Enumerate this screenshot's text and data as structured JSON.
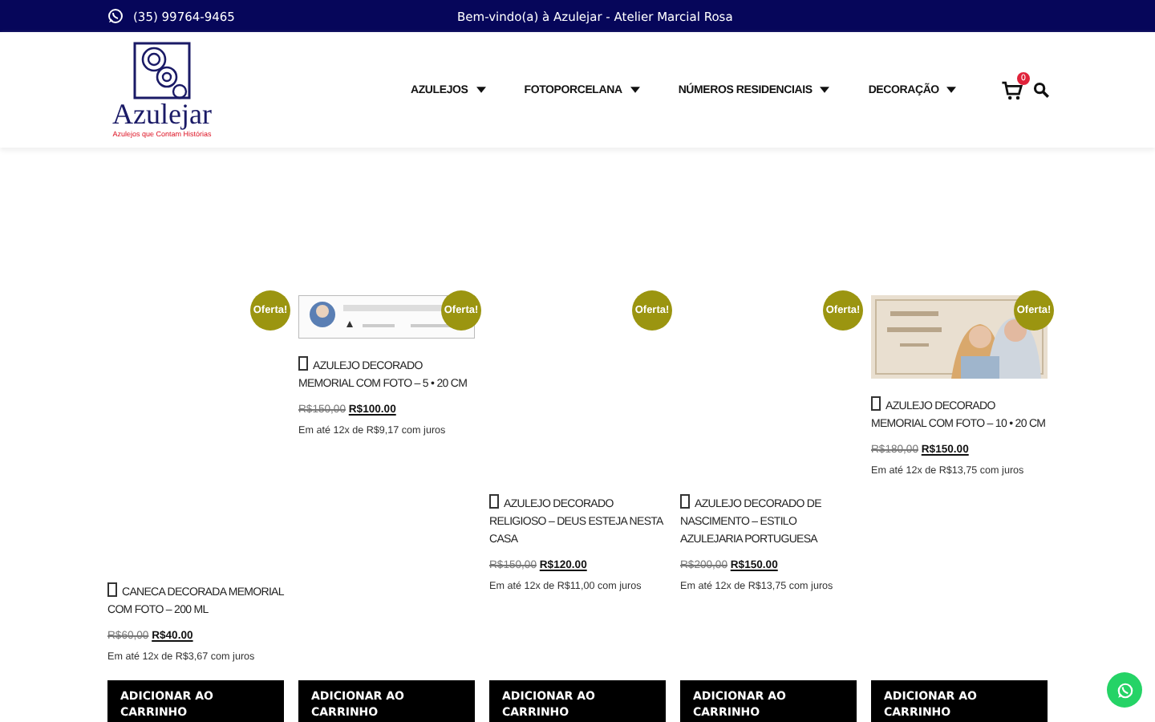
{
  "topbar": {
    "phone": "(35) 99764-9465",
    "welcome": "Bem-vindo(a) à Azulejar - Atelier Marcial Rosa"
  },
  "logo": {
    "name": "Azulejar",
    "tagline": "Azulejos que Contam Histórias"
  },
  "nav": [
    {
      "label": "AZULEJOS"
    },
    {
      "label": "FOTOPORCELANA"
    },
    {
      "label": "NÚMEROS RESIDENCIAIS"
    },
    {
      "label": "DECORAÇÃO"
    }
  ],
  "cart": {
    "count": "0"
  },
  "products": [
    {
      "badge": "Oferta!",
      "title": "CANECA DECORADA MEMORIAL COM FOTO – 200 ML",
      "old_price": "R$60,00",
      "price": "R$40.00",
      "installments": "Em até 12x de R$3,67 com juros",
      "button": "ADICIONAR AO CARRINHO"
    },
    {
      "badge": "Oferta!",
      "kind": "picture",
      "title": "AZULEJO DECORADO MEMORIAL COM FOTO – 5 • 20 CM",
      "old_price": "R$150,00",
      "price": "R$100.00",
      "installments": "Em até 12x de R$9,17 com juros",
      "button": "ADICIONAR AO CARRINHO"
    },
    {
      "badge": "Oferta!",
      "title": "AZULEJO DECORADO RELIGIOSO – DEUS ESTEJA NESTA CASA",
      "old_price": "R$150,00",
      "price": "R$120.00",
      "installments": "Em até 12x de R$11,00 com juros",
      "button": "ADICIONAR AO CARRINHO"
    },
    {
      "badge": "Oferta!",
      "title": "AZULEJO DECORADO DE NASCIMENTO – ESTILO AZULEJARIA PORTUGUESA",
      "old_price": "R$200,00",
      "price": "R$150.00",
      "installments": "Em até 12x de R$13,75 com juros",
      "button": "ADICIONAR AO CARRINHO"
    },
    {
      "badge": "Oferta!",
      "kind": "picture",
      "title": "AZULEJO DECORADO MEMORIAL COM FOTO – 10 • 20 CM",
      "old_price": "R$180,00",
      "price": "R$150.00",
      "installments": "Em até 12x de R$13,75 com juros",
      "button": "ADICIONAR AO CARRINHO"
    }
  ]
}
